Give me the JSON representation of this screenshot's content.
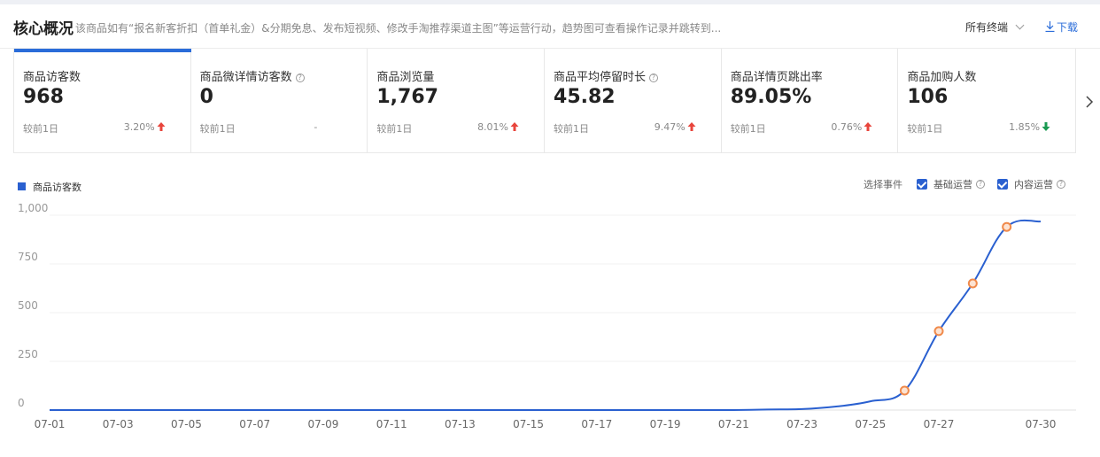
{
  "header": {
    "title": "核心概况",
    "description": "该商品如有“报名新客折扣（首单礼金）&分期免息、发布短视频、修改手淘推荐渠道主图”等运营行动，趋势图可查看操作记录并跳转到...",
    "terminal": "所有终端",
    "download": "下载"
  },
  "cards": [
    {
      "label": "商品访客数",
      "help": false,
      "value": "968",
      "compare": "较前1日",
      "pct": "3.20%",
      "trend": "up",
      "active": true
    },
    {
      "label": "商品微详情访客数",
      "help": true,
      "value": "0",
      "compare": "较前1日",
      "pct": "-",
      "trend": "none",
      "active": false
    },
    {
      "label": "商品浏览量",
      "help": false,
      "value": "1,767",
      "compare": "较前1日",
      "pct": "8.01%",
      "trend": "up",
      "active": false
    },
    {
      "label": "商品平均停留时长",
      "help": true,
      "value": "45.82",
      "compare": "较前1日",
      "pct": "9.47%",
      "trend": "up",
      "active": false
    },
    {
      "label": "商品详情页跳出率",
      "help": false,
      "value": "89.05%",
      "compare": "较前1日",
      "pct": "0.76%",
      "trend": "up",
      "active": false
    },
    {
      "label": "商品加购人数",
      "help": false,
      "value": "106",
      "compare": "较前1日",
      "pct": "1.85%",
      "trend": "down",
      "active": false
    }
  ],
  "colors": {
    "accent": "#2a60d0",
    "up": "#e8453c",
    "down": "#1a9a52",
    "marker": "#f08a4b"
  },
  "legend": {
    "label": "商品访客数"
  },
  "events": {
    "label": "选择事件",
    "options": [
      {
        "label": "基础运营",
        "checked": true
      },
      {
        "label": "内容运营",
        "checked": true
      }
    ]
  },
  "chart_data": {
    "type": "line",
    "ylim": [
      0,
      1000
    ],
    "yticks": [
      0,
      250,
      500,
      750,
      1000
    ],
    "ytick_labels": [
      "0",
      "250",
      "500",
      "750",
      "1,000"
    ],
    "xtick_labels": [
      "07-01",
      "07-03",
      "07-05",
      "07-07",
      "07-09",
      "07-11",
      "07-13",
      "07-15",
      "07-17",
      "07-19",
      "07-21",
      "07-23",
      "07-25",
      "07-27",
      "07-30"
    ],
    "xtick_days": [
      1,
      3,
      5,
      7,
      9,
      11,
      13,
      15,
      17,
      19,
      21,
      23,
      25,
      27,
      30
    ],
    "series": [
      {
        "name": "商品访客数",
        "x": [
          1,
          2,
          3,
          4,
          5,
          6,
          7,
          8,
          9,
          10,
          11,
          12,
          13,
          14,
          15,
          16,
          17,
          18,
          19,
          20,
          21,
          22,
          23,
          24,
          25,
          26,
          27,
          28,
          29,
          30
        ],
        "values": [
          0,
          0,
          0,
          0,
          0,
          0,
          0,
          0,
          0,
          0,
          0,
          0,
          0,
          0,
          0,
          0,
          0,
          0,
          0,
          0,
          0,
          3,
          5,
          18,
          45,
          100,
          405,
          650,
          940,
          968
        ]
      }
    ],
    "event_markers": [
      26,
      27,
      28,
      29
    ]
  }
}
